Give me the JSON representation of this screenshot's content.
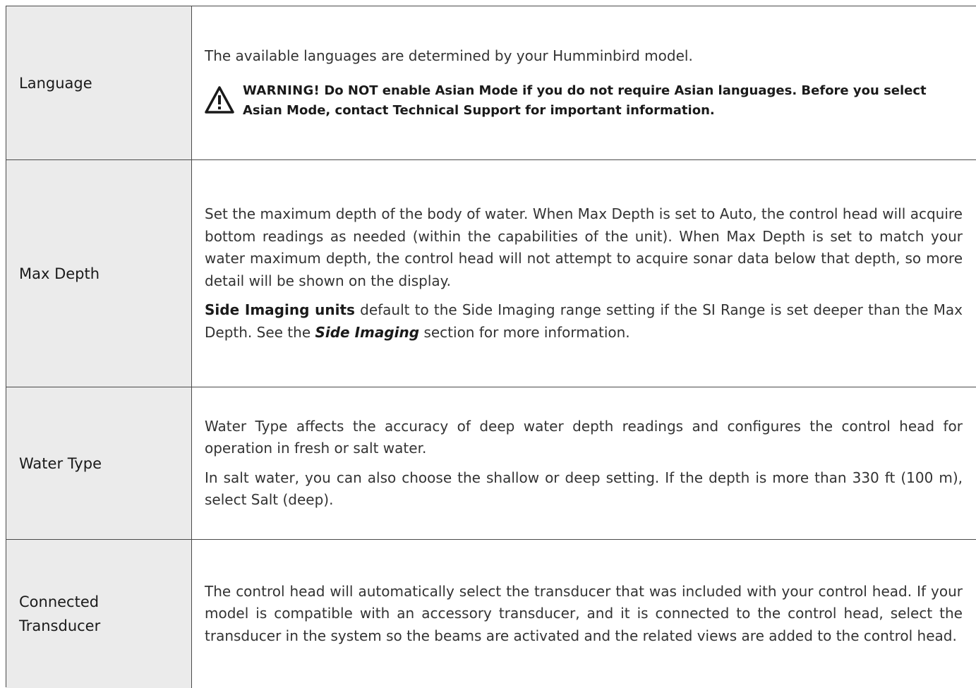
{
  "rows": [
    {
      "label": "Language",
      "intro": "The available languages are determined by your Humminbird model.",
      "warning": {
        "icon": "warning-triangle-icon",
        "label": "WARNING!",
        "text": " Do NOT enable Asian Mode if you do not require Asian languages. Before you select Asian Mode, contact Technical Support for important information."
      }
    },
    {
      "label": "Max Depth",
      "p1": "Set the maximum depth of the body of water. When Max Depth is set to Auto, the control head will acquire bottom readings as needed (within the capabilities of the unit). When Max Depth is set to match your water maximum depth, the control head will not attempt to acquire sonar data below that depth, so more detail will be shown on the display.",
      "p2_lead": "Side Imaging units",
      "p2_mid": " default to the Side Imaging range setting if the SI Range is set deeper than the Max Depth. See the ",
      "p2_ref": "Side Imaging",
      "p2_end": " section for more information."
    },
    {
      "label": "Water Type",
      "p1": "Water Type affects the accuracy of deep water depth readings and configures the control head for operation in fresh or salt water.",
      "p2": "In salt water, you can also choose the shallow or deep setting. If the depth is more than 330 ft (100 m), select Salt (deep)."
    },
    {
      "label_line1": "Connected",
      "label_line2": "Transducer",
      "p1": "The control head will automatically select the transducer that was included with your control head. If your model is compatible with an accessory transducer, and it is connected to the control head, select the transducer in the system so the beams are activated and the related views are added to the control head."
    }
  ]
}
